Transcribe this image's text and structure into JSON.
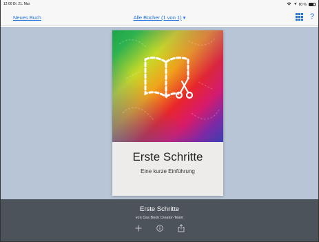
{
  "status_bar": {
    "time": "12:00  Di. 21. Mai",
    "battery_text": "80 %",
    "battery_level": 0.8
  },
  "nav": {
    "left_label": "Neues Buch",
    "title": "Alle Bücher (1 von 1)",
    "title_caret": "▾",
    "help_label": "?"
  },
  "book": {
    "cover_title": "Erste Schritte",
    "cover_subtitle": "Eine kurze Einführung"
  },
  "bottom": {
    "title": "Erste Schritte",
    "author": "von Das Book Creator-Team",
    "actions": [
      {
        "icon": "plus-icon"
      },
      {
        "icon": "info-icon"
      },
      {
        "icon": "share-icon"
      }
    ]
  }
}
